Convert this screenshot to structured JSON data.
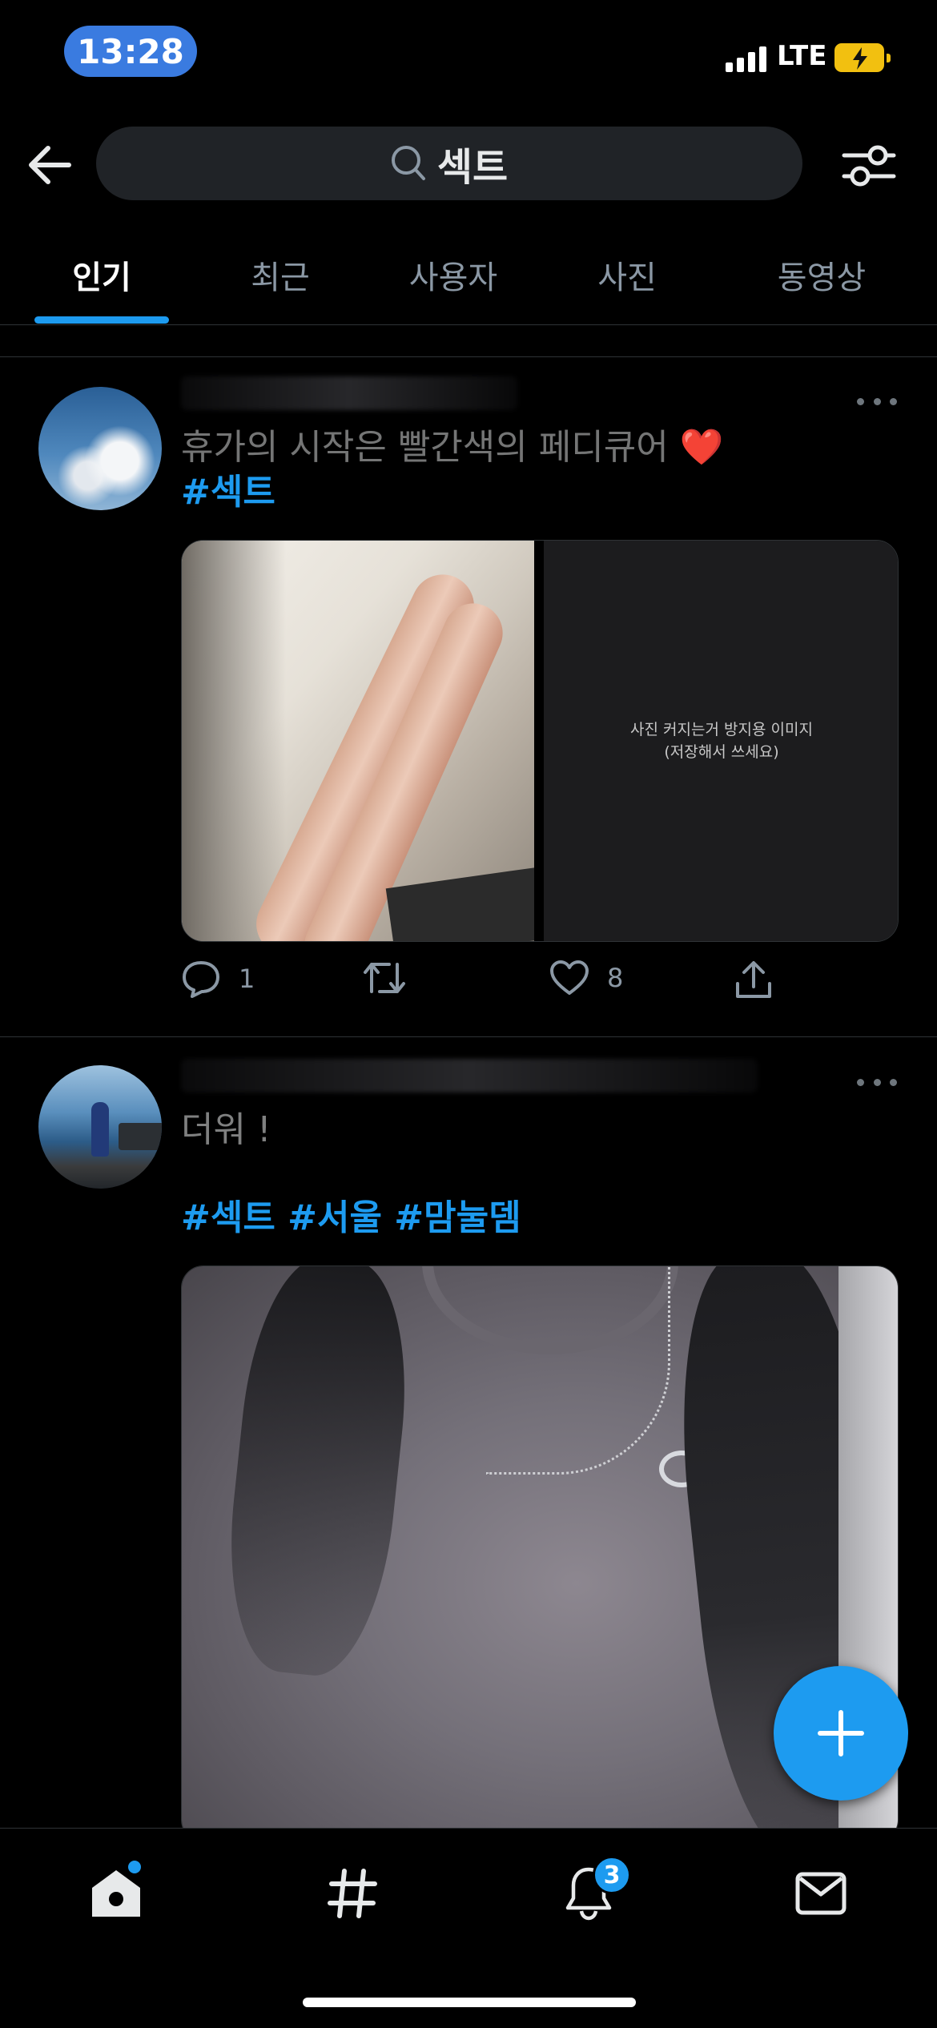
{
  "status_bar": {
    "time": "13:28",
    "network": "LTE"
  },
  "search": {
    "query": "섹트"
  },
  "tabs": [
    {
      "label": "인기",
      "active": true
    },
    {
      "label": "최근",
      "active": false
    },
    {
      "label": "사용자",
      "active": false
    },
    {
      "label": "사진",
      "active": false
    },
    {
      "label": "동영상",
      "active": false
    }
  ],
  "posts": [
    {
      "text_line": "휴가의 시작은 빨간색의 페디큐어",
      "emoji": "❤️",
      "hashtags": "#섹트",
      "image_caption_line1": "사진 커지는거 방지용 이미지",
      "image_caption_line2": "(저장해서 쓰세요)",
      "replies": "1",
      "likes": "8"
    },
    {
      "text_line": "더워 !",
      "hashtags": "#섹트 #서울 #맘눌뎀"
    }
  ],
  "bottom_nav": {
    "notifications_badge": "3"
  },
  "colors": {
    "accent": "#1d9bf0",
    "time_pill": "#3a7be0",
    "battery": "#f2c010",
    "background": "#000000"
  }
}
